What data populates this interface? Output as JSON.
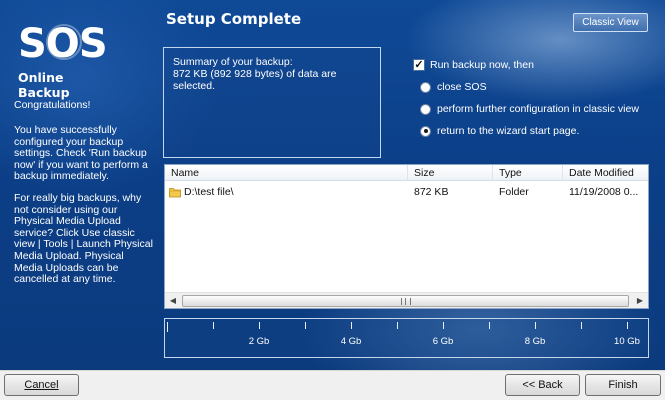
{
  "logo": {
    "title": "SOS",
    "subtitle": "Online Backup"
  },
  "sidebar": {
    "congrats": "Congratulations!",
    "paragraph1": "You have successfully configured your backup settings. Check 'Run backup now' if you want to perform a backup immediately.",
    "paragraph2": "For really big backups, why not consider using our Physical Media Upload service? Click Use classic view | Tools | Launch Physical Media Upload. Physical Media Uploads can be cancelled at any time."
  },
  "header": {
    "title": "Setup Complete",
    "classic_view_label": "Classic View"
  },
  "summary": {
    "line1": "Summary of your backup:",
    "line2": "872 KB (892 928 bytes) of data are selected."
  },
  "options": {
    "run_now_label": "Run backup now, then",
    "run_now_checked": true,
    "radios": [
      {
        "label": "close SOS",
        "selected": false
      },
      {
        "label": "perform further configuration in classic view",
        "selected": false
      },
      {
        "label": "return to the wizard start page.",
        "selected": true
      }
    ]
  },
  "file_list": {
    "columns": [
      "Name",
      "Size",
      "Type",
      "Date Modified"
    ],
    "rows": [
      {
        "name": "D:\\test file\\",
        "size": "872 KB",
        "type": "Folder",
        "date": "11/19/2008 0...",
        "icon": "folder-icon"
      }
    ],
    "scrollbar": {
      "left_arrow": "◀",
      "right_arrow": "▶"
    }
  },
  "size_ruler": {
    "labels": [
      "2 Gb",
      "4 Gb",
      "6 Gb",
      "8 Gb",
      "10 Gb"
    ]
  },
  "footer": {
    "cancel_label": "Cancel",
    "back_label": "<< Back",
    "finish_label": "Finish"
  },
  "colors": {
    "background": "#0c3f88",
    "accent": "#3f6fb0",
    "button_face": "#e6e6e6"
  }
}
